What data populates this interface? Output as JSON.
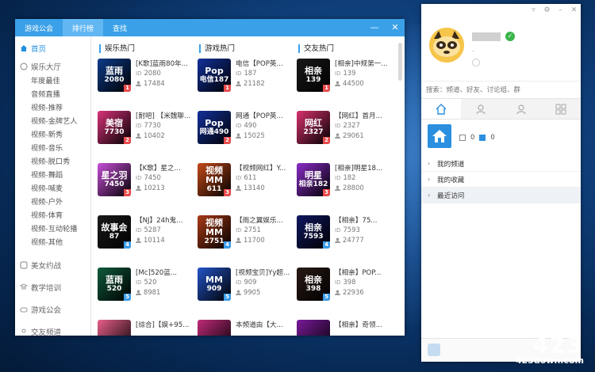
{
  "main_window": {
    "tabs": [
      {
        "label": "游戏公会",
        "active": false
      },
      {
        "label": "排行榜",
        "active": true
      },
      {
        "label": "查找",
        "active": false
      }
    ],
    "controls": {
      "minimize": "—",
      "close": "✕"
    }
  },
  "sidebar": {
    "home": "首页",
    "groups": [
      {
        "label": "娱乐大厅",
        "items": [
          "年度最佳",
          "音频直播",
          "视频-推荐",
          "视频-金牌艺人",
          "视频-新秀",
          "视频-音乐",
          "视频-脱口秀",
          "视频-舞蹈",
          "视频-喊麦",
          "视频-户外",
          "视频-体育",
          "视频-互动轮播",
          "视频-其他"
        ]
      },
      {
        "label": "美女约战",
        "items": []
      },
      {
        "label": "教学培训",
        "items": []
      },
      {
        "label": "游戏公会",
        "items": []
      },
      {
        "label": "交友频道",
        "items": []
      }
    ]
  },
  "columns": [
    {
      "heading": "娱乐热门",
      "cards": [
        {
          "title": "[K歌]蓝雨80年...",
          "id": "2080",
          "count": "17484",
          "thumb": "蓝雨",
          "thumb_sub": "2080",
          "rank": "1",
          "color": "#0d3b8a"
        },
        {
          "title": "[耐吧] 【米魏聊...",
          "id": "7730",
          "count": "10402",
          "thumb": "美宿",
          "thumb_sub": "7730",
          "rank": "2",
          "color": "#d8327a"
        },
        {
          "title": "【K歌】星之...",
          "id": "7450",
          "count": "10213",
          "thumb": "星之羽",
          "thumb_sub": "7450",
          "rank": "3",
          "color": "#c84fd8"
        },
        {
          "title": "【NJ】24h鬼...",
          "id": "5287",
          "count": "10114",
          "thumb": "故事会",
          "thumb_sub": "87",
          "rank": "4",
          "color": "#1a1a1a"
        },
        {
          "title": "[Mc]520蓝...",
          "id": "520",
          "count": "8981",
          "thumb": "蓝雨",
          "thumb_sub": "520",
          "rank": "5",
          "color": "#0f5a3c"
        },
        {
          "title": "[综合]【娱+95...",
          "id": "",
          "count": "",
          "thumb": "",
          "thumb_sub": "",
          "rank": "",
          "color": "#e85f8a"
        }
      ]
    },
    {
      "heading": "游戏热门",
      "cards": [
        {
          "title": "电信【POP英...",
          "id": "187",
          "count": "21182",
          "thumb": "Pop",
          "thumb_sub": "电信187",
          "rank": "1",
          "color": "#12309a"
        },
        {
          "title": "网通【POP英...",
          "id": "490",
          "count": "15025",
          "thumb": "Pop",
          "thumb_sub": "网通490",
          "rank": "2",
          "color": "#12309a"
        },
        {
          "title": "【视频网红】Y...",
          "id": "611",
          "count": "13140",
          "thumb": "视频MM",
          "thumb_sub": "611",
          "rank": "3",
          "color": "#c44a1a"
        },
        {
          "title": "【雨之翼娱乐...",
          "id": "2751",
          "count": "11700",
          "thumb": "视频MM",
          "thumb_sub": "2751",
          "rank": "4",
          "color": "#a83a16"
        },
        {
          "title": "[视频宝贝]Yy超...",
          "id": "909",
          "count": "9905",
          "thumb": "MM",
          "thumb_sub": "909",
          "rank": "5",
          "color": "#2454c8"
        },
        {
          "title": "本频道由【大...",
          "id": "",
          "count": "",
          "thumb": "",
          "thumb_sub": "",
          "rank": "",
          "color": "#c02a7a"
        }
      ]
    },
    {
      "heading": "交友热门",
      "cards": [
        {
          "title": "[相亲]中规第一...",
          "id": "139",
          "count": "44500",
          "thumb": "相亲",
          "thumb_sub": "139",
          "rank": "1",
          "color": "#1a1a1a"
        },
        {
          "title": "【网红】首月...",
          "id": "2327",
          "count": "29061",
          "thumb": "网红",
          "thumb_sub": "2327",
          "rank": "2",
          "color": "#d8326e"
        },
        {
          "title": "[相亲]明星18...",
          "id": "182",
          "count": "28800",
          "thumb": "明星",
          "thumb_sub": "相亲182",
          "rank": "3",
          "color": "#8a2cc8"
        },
        {
          "title": "【相亲】75...",
          "id": "7593",
          "count": "24777",
          "thumb": "相亲",
          "thumb_sub": "7593",
          "rank": "4",
          "color": "#101860"
        },
        {
          "title": "【相亲】POP...",
          "id": "398",
          "count": "22936",
          "thumb": "相亲",
          "thumb_sub": "398",
          "rank": "5",
          "color": "#2a1a14"
        },
        {
          "title": "【相亲】奇领...",
          "id": "",
          "count": "",
          "thumb": "",
          "thumb_sub": "",
          "rank": "",
          "color": "#7a1a9a"
        }
      ]
    }
  ],
  "id_label": "ID",
  "side_panel": {
    "search_placeholder": "搜索：频道、好友、讨论组、群",
    "dash": "-",
    "stats": {
      "a": "0",
      "b": "0"
    },
    "list": [
      "我的频道",
      "我的收藏",
      "最近访问"
    ]
  },
  "watermark": {
    "number": "423",
    "url": "423down.com"
  }
}
